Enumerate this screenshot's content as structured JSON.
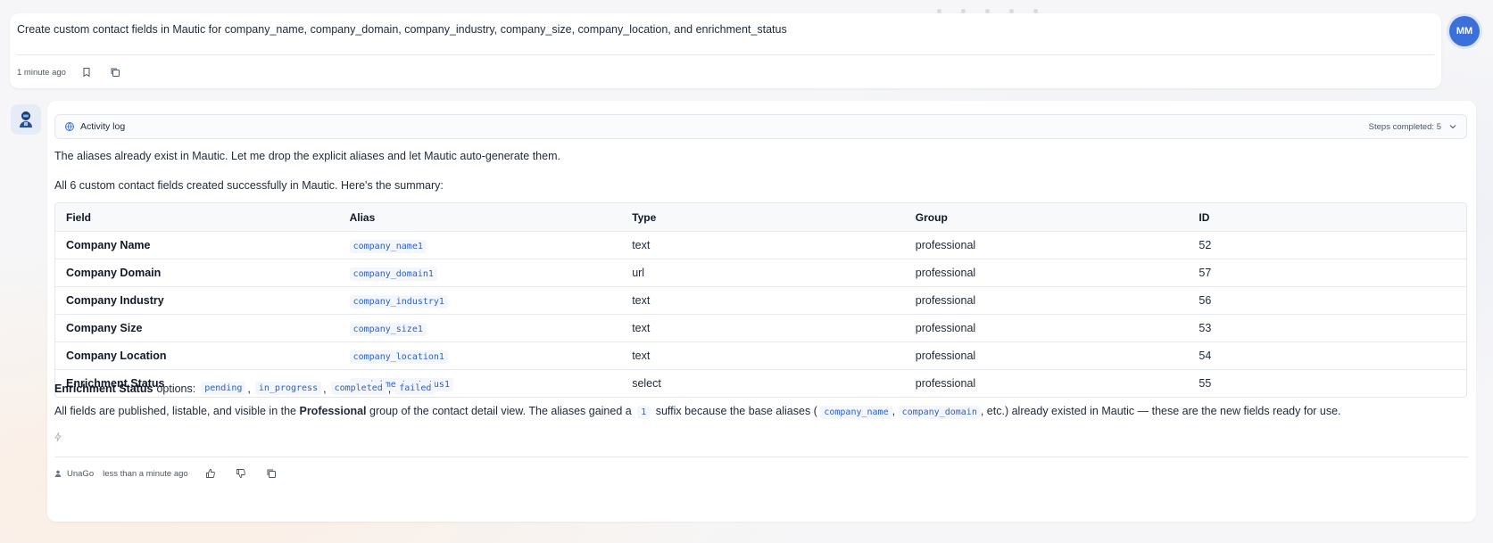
{
  "user_message": {
    "text": "Create custom contact fields in Mautic for company_name, company_domain, company_industry, company_size, company_location, and enrichment_status",
    "time": "1 minute ago",
    "avatar_initials": "MM"
  },
  "assistant": {
    "activity_log": {
      "title": "Activity log",
      "steps": "Steps completed: 5"
    },
    "paragraph1": "The aliases already exist in Mautic. Let me drop the explicit aliases and let Mautic auto-generate them.",
    "paragraph2": "All 6 custom contact fields created successfully in Mautic. Here's the summary:",
    "table": {
      "headers": [
        "Field",
        "Alias",
        "Type",
        "Group",
        "ID"
      ],
      "rows": [
        [
          "Company Name",
          "company_name1",
          "text",
          "professional",
          "52"
        ],
        [
          "Company Domain",
          "company_domain1",
          "url",
          "professional",
          "57"
        ],
        [
          "Company Industry",
          "company_industry1",
          "text",
          "professional",
          "56"
        ],
        [
          "Company Size",
          "company_size1",
          "text",
          "professional",
          "53"
        ],
        [
          "Company Location",
          "company_location1",
          "text",
          "professional",
          "54"
        ],
        [
          "Enrichment Status",
          "enrichment_status1",
          "select",
          "professional",
          "55"
        ]
      ]
    },
    "options_line": {
      "label": "Enrichment Status",
      "suffix": "options:",
      "options": [
        "pending",
        "in_progress",
        "completed",
        "failed"
      ]
    },
    "summary": {
      "part1": "All fields are published, listable, and visible in the",
      "bold": "Professional",
      "part2": "group of the contact detail view. The aliases gained a",
      "code1": "1",
      "part3": "suffix because the base aliases (",
      "code2": "company_name",
      "comma": ",",
      "code3": "company_domain",
      "part4": ", etc.) already existed in Mautic — these are the new fields ready for use."
    },
    "footer": {
      "user": "UnaGo",
      "time": "less than a minute ago"
    }
  },
  "colors": {
    "accent": "#3b6fd9",
    "code_text": "#2f5fc4"
  }
}
